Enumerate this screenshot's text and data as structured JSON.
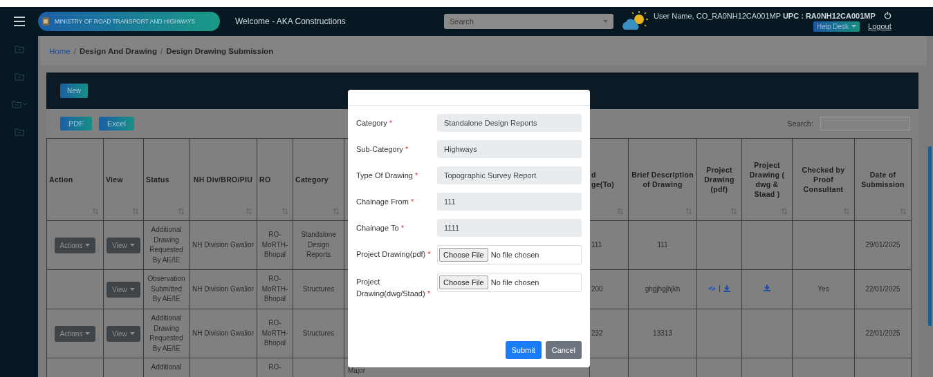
{
  "topbar": {
    "logo_text": "MINISTRY OF ROAD TRANSPORT AND HIGHWAYS",
    "welcome": "Welcome - AKA Constructions",
    "search": {
      "placeholder": "Search"
    },
    "user_info": "User Name, CO_RA0NH12CA001MP **UPC : RA0NH12CA001MP**",
    "help_desk": "Help Desk",
    "logout": "Logout"
  },
  "sidebar": {
    "items": [
      {
        "has_submenu": false
      },
      {
        "has_submenu": false
      },
      {
        "has_submenu": true
      },
      {
        "has_submenu": false
      }
    ]
  },
  "breadcrumb": [
    {
      "label": "Home",
      "link": true
    },
    {
      "separator": "/",
      "label": "Design And Drawing",
      "link": false
    },
    {
      "separator": "/",
      "label": "Design Drawing Submission",
      "link": false
    }
  ],
  "panel": {
    "new_button": "New",
    "export_buttons": [
      "PDF",
      "Excel"
    ],
    "search_label": "Search:"
  },
  "table": {
    "columns": [
      {
        "kind": "header",
        "label": "Action"
      },
      {
        "kind": "header",
        "label": "View"
      },
      {
        "kind": "header",
        "label": "Status"
      },
      {
        "kind": "header",
        "label": "NH Div/BRO/PIU"
      },
      {
        "kind": "header",
        "label": "RO"
      },
      {
        "kind": "header",
        "label": "Category"
      },
      {
        "kind": "covered"
      },
      {
        "kind": "header",
        "label": "d ge(To)"
      },
      {
        "kind": "header",
        "label": "Brief Description of Drawing"
      },
      {
        "kind": "header",
        "label": "Project Drawing (pdf)"
      },
      {
        "kind": "header",
        "label": "Project Drawing ( dwg & Staad )"
      },
      {
        "kind": "header",
        "label": "Checked by Proof Consultant"
      },
      {
        "kind": "header",
        "label": "Date of Submission"
      }
    ],
    "rows": [
      {
        "cells": [
          {
            "kind": "actions",
            "label": "Actions"
          },
          {
            "kind": "view",
            "label": "View"
          },
          {
            "kind": "text",
            "text": "Additional Drawing Requested By AE/IE"
          },
          {
            "kind": "text",
            "text": "NH Division Gwalior"
          },
          {
            "kind": "text",
            "text": "RO-MoRTH-Bhopal"
          },
          {
            "kind": "text",
            "text": "Standalone Design Reports"
          },
          {
            "kind": "empty"
          },
          {
            "kind": "text",
            "text": "111"
          },
          {
            "kind": "text",
            "text": "111"
          },
          {
            "kind": "empty"
          },
          {
            "kind": "empty"
          },
          {
            "kind": "empty"
          },
          {
            "kind": "text",
            "text": "29/01/2025"
          }
        ]
      },
      {
        "cells": [
          {
            "kind": "empty"
          },
          {
            "kind": "view",
            "label": "View"
          },
          {
            "kind": "text",
            "text": "Observation Submitted By AE/IE"
          },
          {
            "kind": "text",
            "text": "NH Division Gwalior"
          },
          {
            "kind": "text",
            "text": "RO-MoRTH-Bhopal"
          },
          {
            "kind": "text",
            "text": "Structures"
          },
          {
            "kind": "empty"
          },
          {
            "kind": "text",
            "text": "200"
          },
          {
            "kind": "text",
            "text": "ghgjhgjhjkh"
          },
          {
            "kind": "view_download",
            "separator": "|"
          },
          {
            "kind": "download"
          },
          {
            "kind": "text",
            "text": "Yes"
          },
          {
            "kind": "text",
            "text": "22/01/2025"
          }
        ]
      },
      {
        "cells": [
          {
            "kind": "actions",
            "label": "Actions"
          },
          {
            "kind": "view",
            "label": "View"
          },
          {
            "kind": "text",
            "text": "Additional Drawing Requested By AE/IE"
          },
          {
            "kind": "text",
            "text": "NH Division Gwalior"
          },
          {
            "kind": "text",
            "text": "RO-MoRTH-Bhopal"
          },
          {
            "kind": "text",
            "text": "Structures"
          },
          {
            "kind": "empty"
          },
          {
            "kind": "text",
            "text": "232"
          },
          {
            "kind": "text",
            "text": "13313"
          },
          {
            "kind": "empty"
          },
          {
            "kind": "empty"
          },
          {
            "kind": "empty"
          },
          {
            "kind": "text",
            "text": "22/01/2025"
          }
        ]
      },
      {
        "cells": [
          {
            "kind": "empty"
          },
          {
            "kind": "empty"
          },
          {
            "kind": "text",
            "text": "Additional"
          },
          {
            "kind": "empty"
          },
          {
            "kind": "text",
            "text": "RO-"
          },
          {
            "kind": "empty"
          },
          {
            "kind": "text",
            "text": "Major"
          },
          {
            "kind": "empty"
          },
          {
            "kind": "empty"
          },
          {
            "kind": "empty"
          },
          {
            "kind": "empty"
          },
          {
            "kind": "empty"
          },
          {
            "kind": "empty"
          }
        ]
      }
    ]
  },
  "modal": {
    "fields": [
      {
        "kind": "readonly",
        "label": "Category",
        "required_mark": "*",
        "value": "Standalone Design Reports"
      },
      {
        "kind": "readonly",
        "label": "Sub-Category",
        "required_mark": "*",
        "value": "Highways"
      },
      {
        "kind": "readonly",
        "label": "Type Of Drawing",
        "required_mark": "*",
        "value": "Topographic Survey Report"
      },
      {
        "kind": "readonly",
        "label": "Chainage From",
        "required_mark": "*",
        "value": "111"
      },
      {
        "kind": "readonly",
        "label": "Chainage To",
        "required_mark": "*",
        "value": "1111"
      },
      {
        "kind": "file",
        "label": "Project Drawing(pdf)",
        "required_mark": "*",
        "button": "Choose File",
        "status": "No file chosen"
      },
      {
        "kind": "file",
        "label": "Project Drawing(dwg/Staad)",
        "required_mark": "*",
        "button": "Choose File",
        "status": "No file chosen"
      }
    ],
    "buttons": [
      {
        "kind": "primary",
        "label": "Submit"
      },
      {
        "kind": "secondary",
        "label": "Cancel"
      }
    ]
  }
}
